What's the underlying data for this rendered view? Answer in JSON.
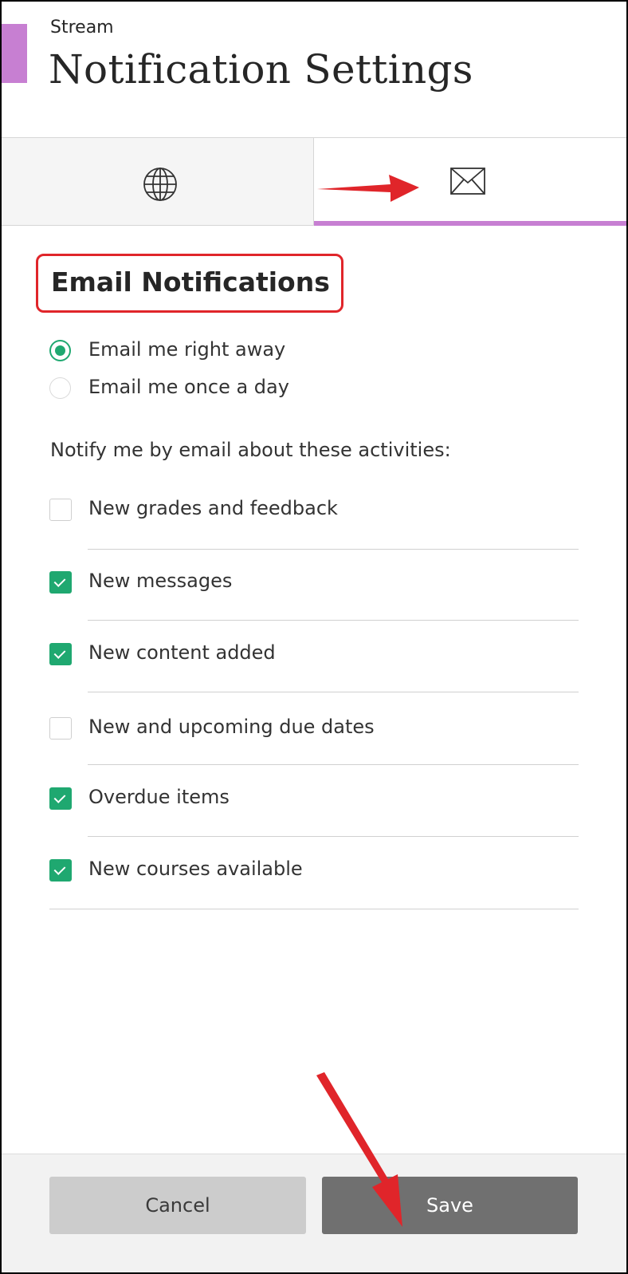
{
  "header": {
    "breadcrumb": "Stream",
    "title": "Notification Settings"
  },
  "tabs": [
    {
      "id": "web",
      "icon": "globe-icon",
      "selected": false
    },
    {
      "id": "email",
      "icon": "envelope-icon",
      "selected": true
    }
  ],
  "section": {
    "title": "Email Notifications"
  },
  "frequency": [
    {
      "label": "Email me right away",
      "selected": true
    },
    {
      "label": "Email me once a day",
      "selected": false
    }
  ],
  "activities": {
    "label": "Notify me by email about these activities:",
    "items": [
      {
        "label": "New grades and feedback",
        "checked": false
      },
      {
        "label": "New messages",
        "checked": true
      },
      {
        "label": "New content added",
        "checked": true
      },
      {
        "label": "New and upcoming due dates",
        "checked": false
      },
      {
        "label": "Overdue items",
        "checked": true
      },
      {
        "label": "New courses available",
        "checked": true
      }
    ]
  },
  "footer": {
    "cancel_label": "Cancel",
    "save_label": "Save"
  },
  "colors": {
    "accent": "#c77fd2",
    "check": "#1fa870",
    "annotation": "#e0252a"
  }
}
